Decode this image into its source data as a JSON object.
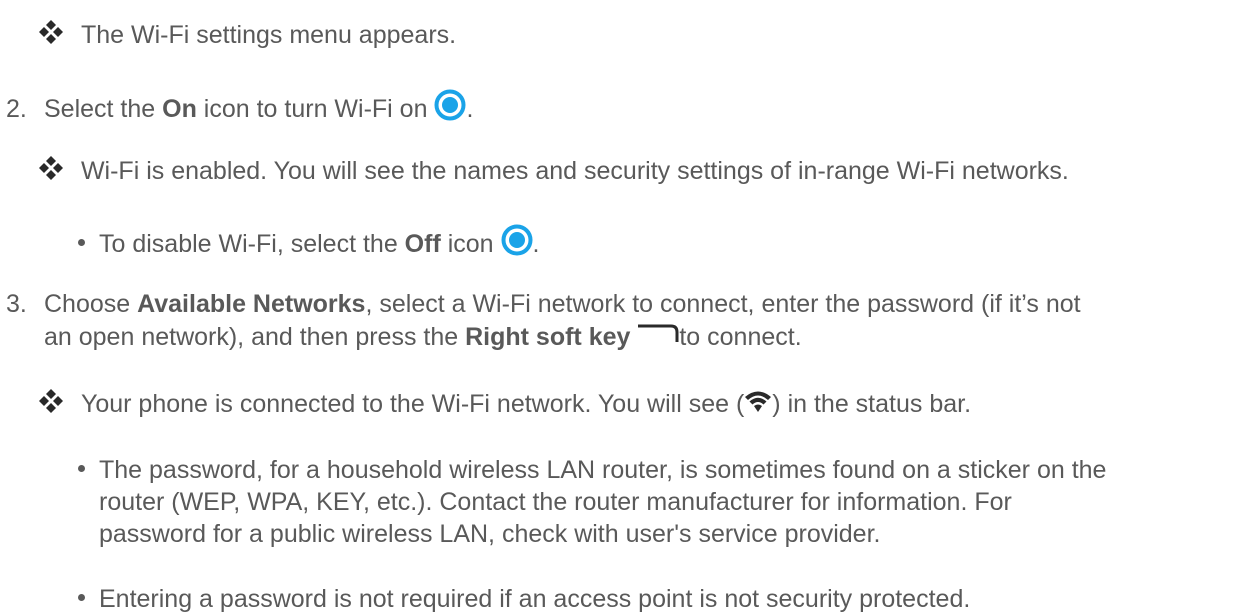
{
  "result1": "The Wi-Fi settings menu appears.",
  "step2": {
    "number": "2.",
    "pre": "Select the ",
    "bold": "On",
    "post": " icon to turn Wi-Fi on",
    "end": "."
  },
  "result2": "Wi-Fi is enabled. You will see the names and security settings of in-range Wi-Fi networks.",
  "bullet_off": {
    "pre": "To disable Wi-Fi, select the ",
    "bold": "Off",
    "post": " icon",
    "end": "."
  },
  "step3": {
    "number": "3.",
    "pre": "Choose ",
    "bold1": "Available Networks",
    "mid": ", select a Wi-Fi network to connect, enter the password (if it’s not",
    "line2_pre": "an open network), and then press the ",
    "bold2": "Right soft key",
    "line2_post": "to connect."
  },
  "result3": {
    "pre": "Your phone is connected to the Wi-Fi network. You will see (",
    "post": ") in the status bar."
  },
  "bullet_password": [
    "The password, for a household wireless LAN router, is sometimes found on a sticker on the",
    "router (WEP, WPA, KEY, etc.). Contact the router manufacturer for information. For",
    "password for a public wireless LAN, check with user's service provider."
  ],
  "bullet_access": "Entering a password is not required if an access point is not security protected.",
  "colors": {
    "text": "#595959",
    "radio": "#1aa3e8",
    "icon": "#2a2a2a"
  },
  "icons": [
    "result-diamond-icon",
    "radio-on-icon",
    "radio-off-icon",
    "right-soft-key-icon",
    "wifi-icon"
  ]
}
